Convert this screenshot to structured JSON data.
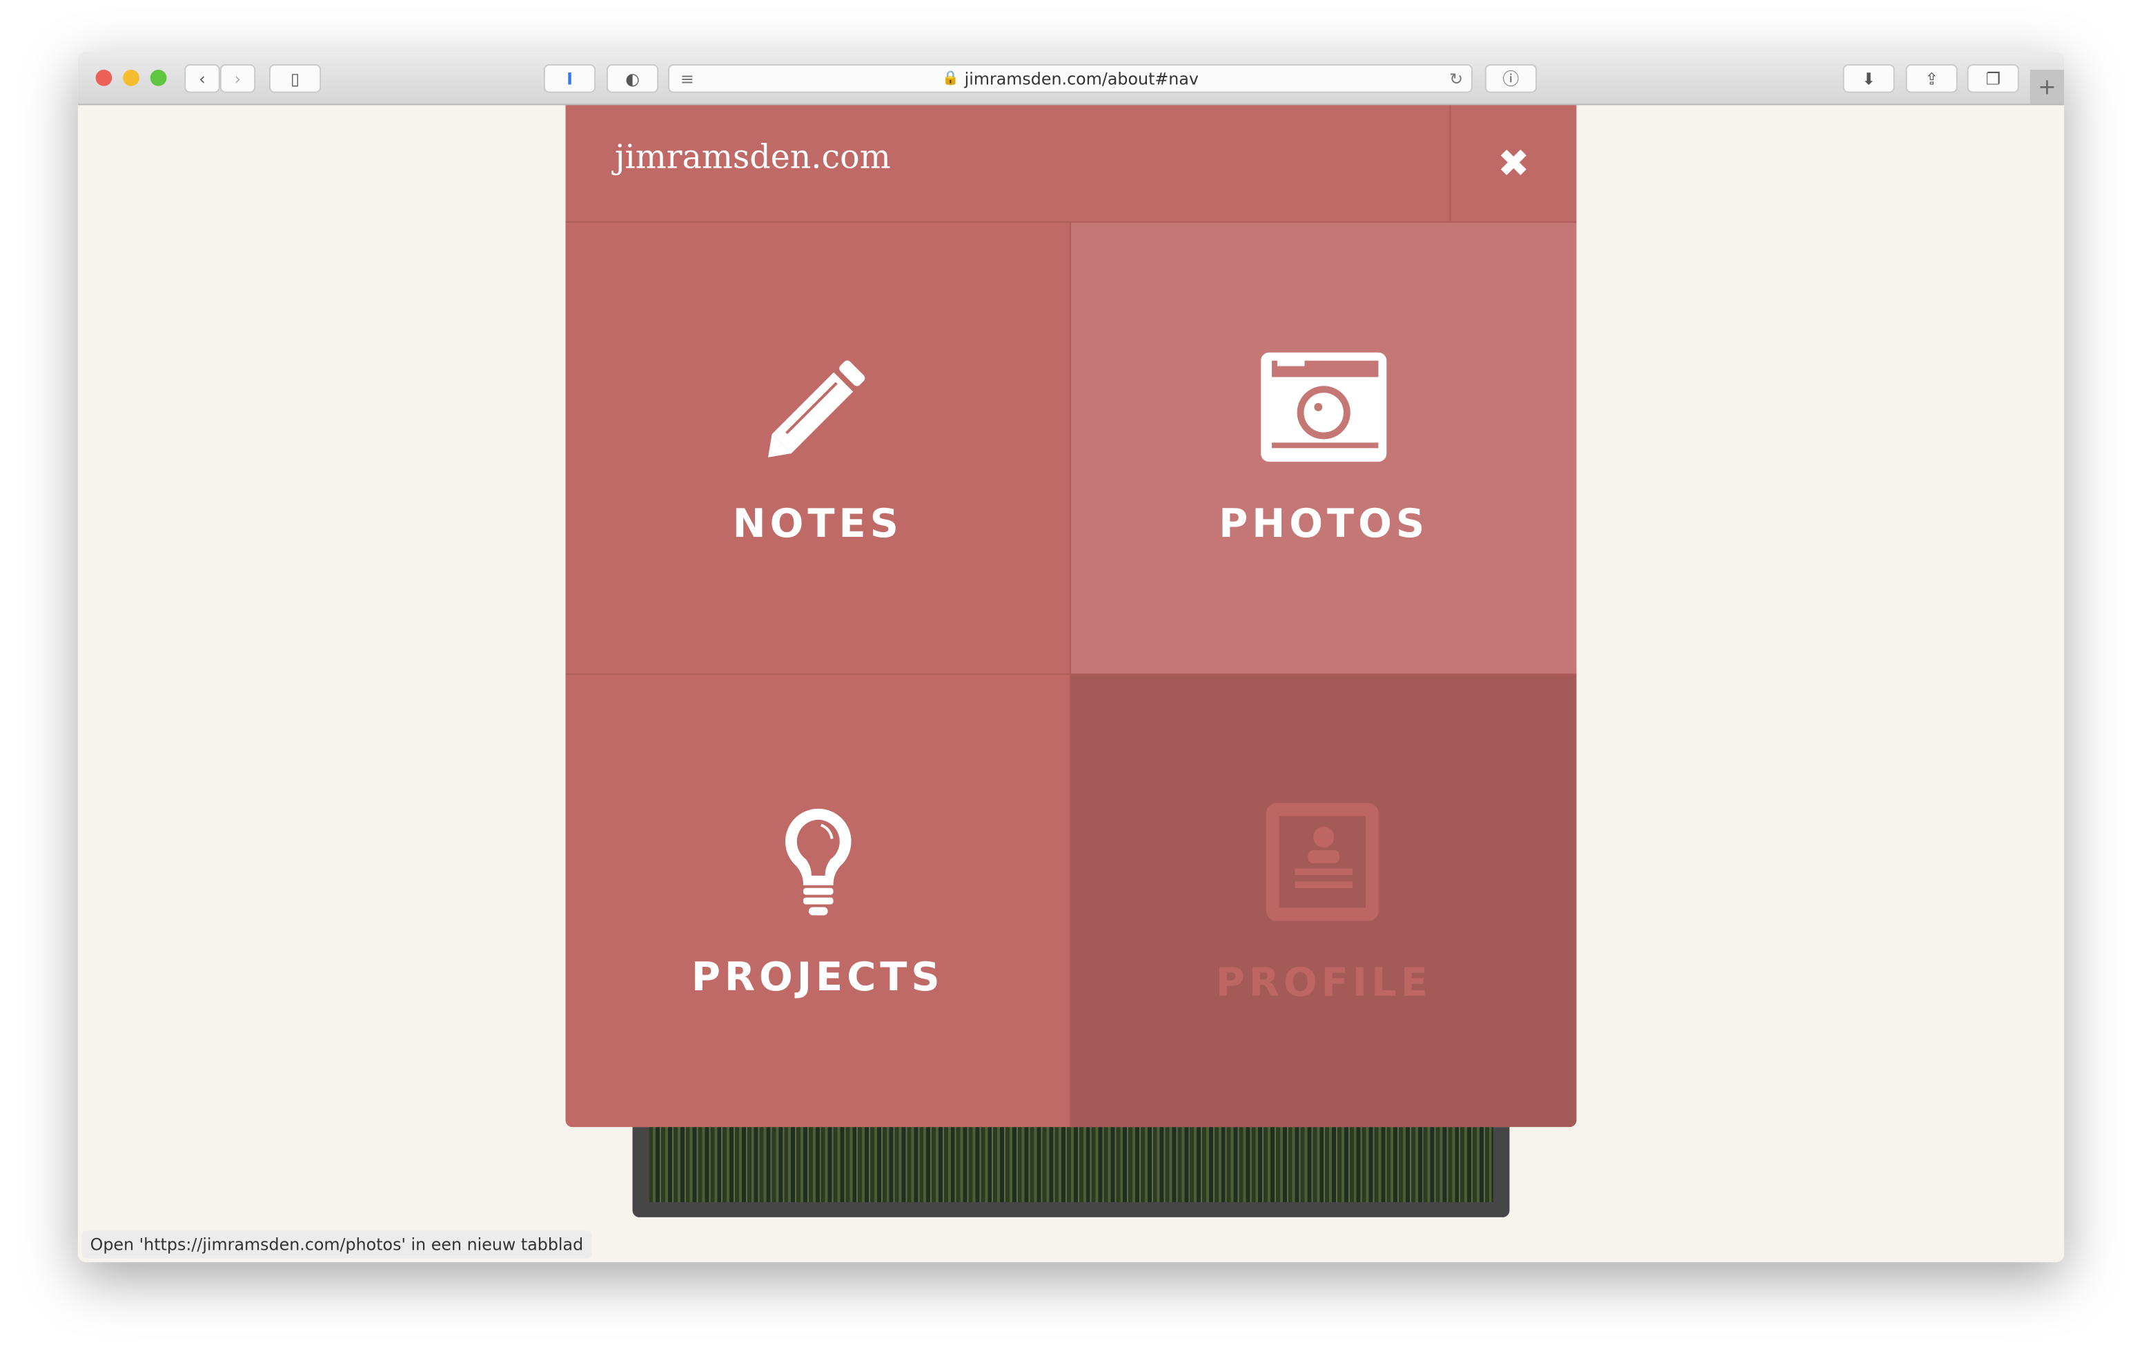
{
  "browser": {
    "url": "jimramsden.com/about#nav",
    "status": "Open 'https://jimramsden.com/photos' in een nieuw tabblad"
  },
  "menu": {
    "site_title": "jimramsden.com",
    "close_icon": "close-icon",
    "tiles": [
      {
        "label": "NOTES",
        "icon": "pencil-icon"
      },
      {
        "label": "PHOTOS",
        "icon": "camera-icon"
      },
      {
        "label": "PROJECTS",
        "icon": "lightbulb-icon"
      },
      {
        "label": "PROFILE",
        "icon": "profile-card-icon",
        "active": true
      }
    ]
  },
  "colors": {
    "tile": "#bf6a67",
    "tile_hover": "#c57775",
    "tile_active": "#a45b58",
    "page_bg": "#f7f4ee"
  }
}
